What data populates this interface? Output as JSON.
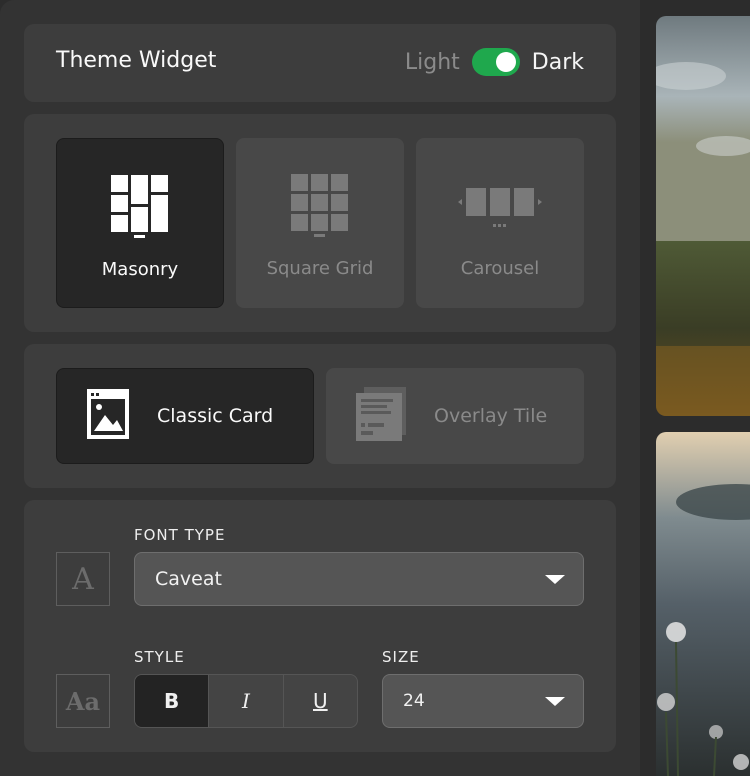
{
  "header": {
    "title": "Theme Widget",
    "theme_light_label": "Light",
    "theme_dark_label": "Dark",
    "theme_toggle_on": true
  },
  "layouts": [
    {
      "label": "Masonry",
      "icon": "masonry-icon",
      "selected": true
    },
    {
      "label": "Square Grid",
      "icon": "square-grid-icon",
      "selected": false
    },
    {
      "label": "Carousel",
      "icon": "carousel-icon",
      "selected": false
    }
  ],
  "card_styles": [
    {
      "label": "Classic Card",
      "icon": "classic-card-icon",
      "selected": true
    },
    {
      "label": "Overlay Tile",
      "icon": "overlay-tile-icon",
      "selected": false
    }
  ],
  "fonts": {
    "font_type_label": "FONT TYPE",
    "font_type_value": "Caveat",
    "font_icon_glyph": "A",
    "style_label": "STYLE",
    "style_icon_glyph": "Aa",
    "style_buttons": [
      {
        "label": "B",
        "name": "bold-button",
        "active": true
      },
      {
        "label": "I",
        "name": "italic-button",
        "active": false
      },
      {
        "label": "U",
        "name": "underline-button",
        "active": false
      }
    ],
    "size_label": "SIZE",
    "size_value": "24"
  },
  "colors": {
    "accent_toggle": "#1fa84d",
    "panel_bg": "#333333",
    "card_bg": "#3d3d3d",
    "selected_bg": "#262626"
  }
}
